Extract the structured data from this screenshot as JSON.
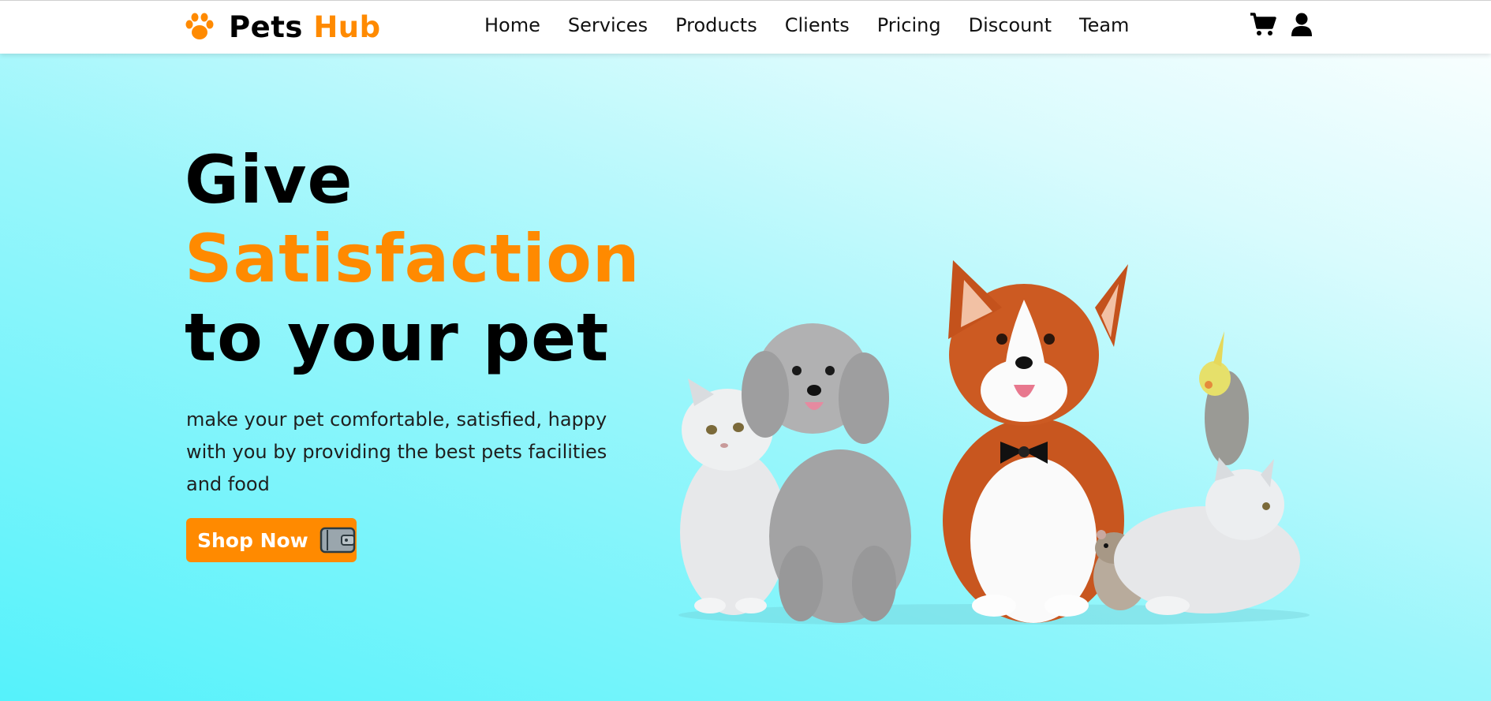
{
  "brand": {
    "name_part1": "Pets",
    "name_part2": "Hub",
    "accent_color": "#ff8a00",
    "icon": "paw-icon"
  },
  "nav": {
    "links": [
      "Home",
      "Services",
      "Products",
      "Clients",
      "Pricing",
      "Discount",
      "Team"
    ],
    "icons": [
      "cart-icon",
      "user-icon"
    ]
  },
  "hero": {
    "title_line1": "Give",
    "title_line2": "Satisfaction",
    "title_line3": "to your pet",
    "description": "make your pet comfortable, satisfied, happy with you by providing the best pets facilities and food",
    "cta_label": "Shop Now",
    "cta_icon": "wallet-icon",
    "background_start": "#55f2fb",
    "background_end": "#ffffff"
  },
  "illustration": {
    "subjects": [
      "cat",
      "poodle",
      "corgi",
      "hamster",
      "cockatiel",
      "cat"
    ]
  }
}
